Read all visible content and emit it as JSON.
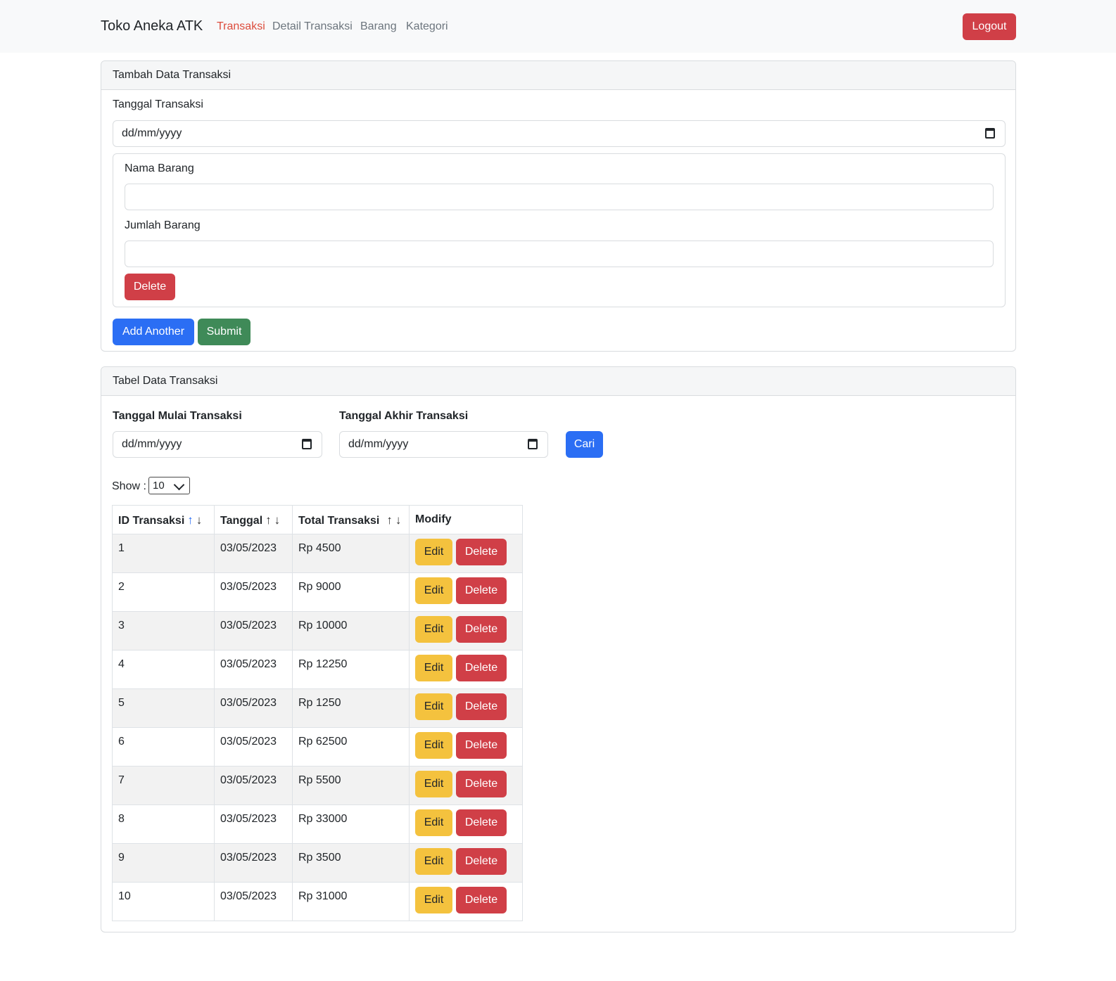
{
  "nav": {
    "brand": "Toko Aneka ATK",
    "links": [
      "Transaksi",
      "Detail Transaksi",
      "Barang",
      "Kategori"
    ],
    "logout": "Logout"
  },
  "add_form": {
    "header": "Tambah Data Transaksi",
    "date_label": "Tanggal Transaksi",
    "date_placeholder": "dd/mm/yyyy",
    "item_label": "Nama Barang",
    "qty_label": "Jumlah Barang",
    "delete": "Delete",
    "add_another": "Add Another",
    "submit": "Submit"
  },
  "table_card": {
    "header": "Tabel Data Transaksi",
    "start_label": "Tanggal Mulai Transaksi",
    "end_label": "Tanggal Akhir Transaksi",
    "date_placeholder": "dd/mm/yyyy",
    "search": "Cari",
    "show_label": "Show :",
    "show_value": "10",
    "columns": [
      "ID Transaksi",
      "Tanggal",
      "Total Transaksi",
      "Modify"
    ],
    "sort_up": "↑",
    "sort_down": "↓",
    "edit": "Edit",
    "delete": "Delete",
    "rows": [
      {
        "id": "1",
        "date": "03/05/2023",
        "total": "Rp 4500"
      },
      {
        "id": "2",
        "date": "03/05/2023",
        "total": "Rp 9000"
      },
      {
        "id": "3",
        "date": "03/05/2023",
        "total": "Rp 10000"
      },
      {
        "id": "4",
        "date": "03/05/2023",
        "total": "Rp 12250"
      },
      {
        "id": "5",
        "date": "03/05/2023",
        "total": "Rp 1250"
      },
      {
        "id": "6",
        "date": "03/05/2023",
        "total": "Rp 62500"
      },
      {
        "id": "7",
        "date": "03/05/2023",
        "total": "Rp 5500"
      },
      {
        "id": "8",
        "date": "03/05/2023",
        "total": "Rp 33000"
      },
      {
        "id": "9",
        "date": "03/05/2023",
        "total": "Rp 3500"
      },
      {
        "id": "10",
        "date": "03/05/2023",
        "total": "Rp 31000"
      }
    ]
  }
}
